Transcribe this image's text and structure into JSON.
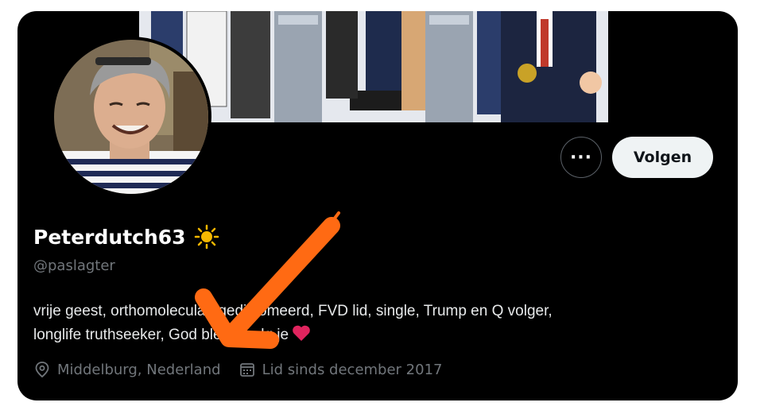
{
  "header": {
    "more_label": "···",
    "follow_label": "Volgen"
  },
  "profile": {
    "display_name": "Peterdutch63",
    "handle": "@paslagter",
    "bio_line1": "vrije geest, orthomoleculair gediplomeerd, FVD lid, single, Trump en Q volger,",
    "bio_line2": "longlife truthseeker, God bless, volg je",
    "location": "Middelburg, Nederland",
    "joined": "Lid sinds december 2017"
  },
  "icons": {
    "sun": "sun-icon",
    "heart": "heart-icon",
    "location": "location-pin-icon",
    "calendar": "calendar-icon",
    "more": "more-icon"
  },
  "colors": {
    "background": "#000000",
    "handle": "#71767b",
    "follow_bg": "#eff3f4",
    "heart": "#f91880",
    "annotation_arrow": "#ff6a13"
  }
}
